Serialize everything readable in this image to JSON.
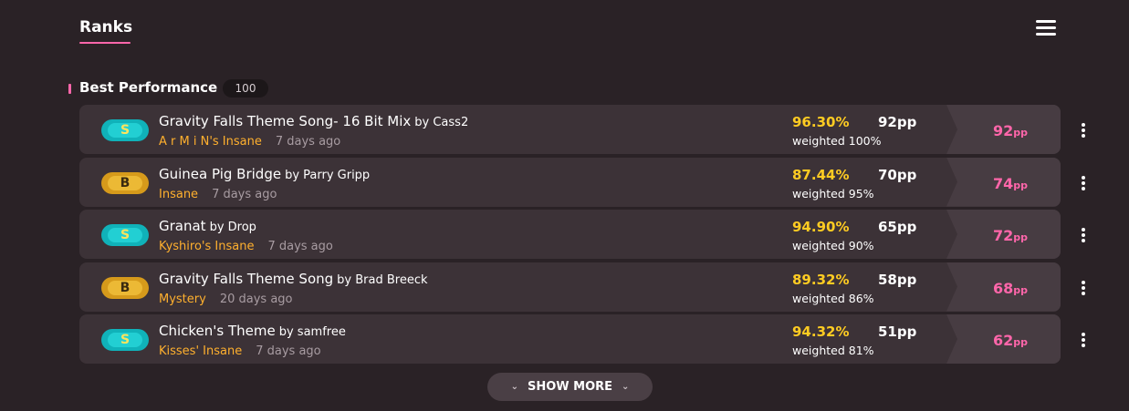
{
  "header": {
    "tab_label": "Ranks",
    "menu_icon": "hamburger-menu-icon"
  },
  "section": {
    "title": "Best Performance",
    "count": "100"
  },
  "scores": [
    {
      "rank": "S",
      "title": "Gravity Falls Theme Song- 16 Bit Mix",
      "artist": "by Cass2",
      "version": "A r M i N's Insane",
      "time_ago": "7 days ago",
      "accuracy": "96.30%",
      "pp": "92pp",
      "weighted": "weighted 100%",
      "weighted_pp": "92",
      "weighted_pp_unit": "pp"
    },
    {
      "rank": "B",
      "title": "Guinea Pig Bridge",
      "artist": "by Parry Gripp",
      "version": "Insane",
      "time_ago": "7 days ago",
      "accuracy": "87.44%",
      "pp": "70pp",
      "weighted": "weighted 95%",
      "weighted_pp": "74",
      "weighted_pp_unit": "pp"
    },
    {
      "rank": "S",
      "title": "Granat",
      "artist": "by Drop",
      "version": "Kyshiro's Insane",
      "time_ago": "7 days ago",
      "accuracy": "94.90%",
      "pp": "65pp",
      "weighted": "weighted 90%",
      "weighted_pp": "72",
      "weighted_pp_unit": "pp"
    },
    {
      "rank": "B",
      "title": "Gravity Falls Theme Song",
      "artist": "by Brad Breeck",
      "version": "Mystery",
      "time_ago": "20 days ago",
      "accuracy": "89.32%",
      "pp": "58pp",
      "weighted": "weighted 86%",
      "weighted_pp": "68",
      "weighted_pp_unit": "pp"
    },
    {
      "rank": "S",
      "title": "Chicken's Theme",
      "artist": "by samfree",
      "version": "Kisses' Insane",
      "time_ago": "7 days ago",
      "accuracy": "94.32%",
      "pp": "51pp",
      "weighted": "weighted 81%",
      "weighted_pp": "62",
      "weighted_pp_unit": "pp"
    }
  ],
  "show_more": {
    "label": "SHOW MORE",
    "icon": "chevron-down-icon"
  },
  "colors": {
    "background": "#2a2226",
    "row": "#3c3237",
    "accent_pink": "#ff66aa",
    "accuracy_yellow": "#ffcc22",
    "version_orange": "#ffb02e",
    "rank_s": "#22cfd3",
    "rank_b": "#ecb935"
  }
}
